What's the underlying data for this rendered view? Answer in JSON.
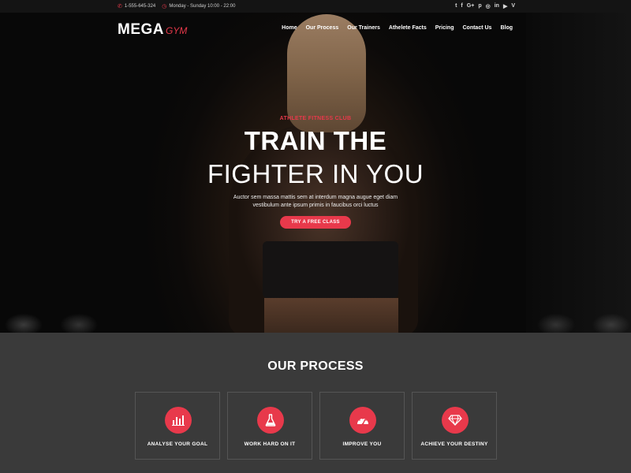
{
  "topbar": {
    "phone": "1-555-645-324",
    "hours": "Monday - Sunday 10:00 - 22:00",
    "social": [
      "twitter-icon",
      "facebook-icon",
      "google-plus-icon",
      "pinterest-icon",
      "instagram-icon",
      "linkedin-icon",
      "youtube-icon",
      "vimeo-icon"
    ],
    "social_glyphs": {
      "twitter": "t",
      "facebook": "f",
      "google": "G+",
      "pinterest": "p",
      "instagram": "◎",
      "linkedin": "in",
      "youtube": "▶",
      "vimeo": "V"
    }
  },
  "logo": {
    "primary": "MEGA",
    "secondary": "GYM"
  },
  "nav": {
    "items": [
      "Home",
      "Our Process",
      "Our Trainers",
      "Athelete Facts",
      "Pricing",
      "Contact Us",
      "Blog"
    ]
  },
  "hero": {
    "kicker": "ATHLETE FITNESS CLUB",
    "title_line1": "TRAIN THE",
    "title_line2": "FIGHTER IN YOU",
    "description_line1": "Auctor sem massa mattis sem at interdum magna augue eget diam",
    "description_line2": "vestibulum ante ipsum primis in faucibus orci luctus",
    "cta_label": "TRY A FREE CLASS"
  },
  "process": {
    "title": "OUR PROCESS",
    "cards": [
      {
        "label": "ANALYSE YOUR GOAL",
        "icon": "bar-chart-icon"
      },
      {
        "label": "WORK HARD ON IT",
        "icon": "flask-icon"
      },
      {
        "label": "IMPROVE YOU",
        "icon": "speedometer-icon"
      },
      {
        "label": "ACHIEVE YOUR DESTINY",
        "icon": "diamond-icon"
      }
    ]
  },
  "colors": {
    "accent": "#e8394b",
    "section_bg": "#3a3a3a",
    "topbar_bg": "#141414"
  }
}
